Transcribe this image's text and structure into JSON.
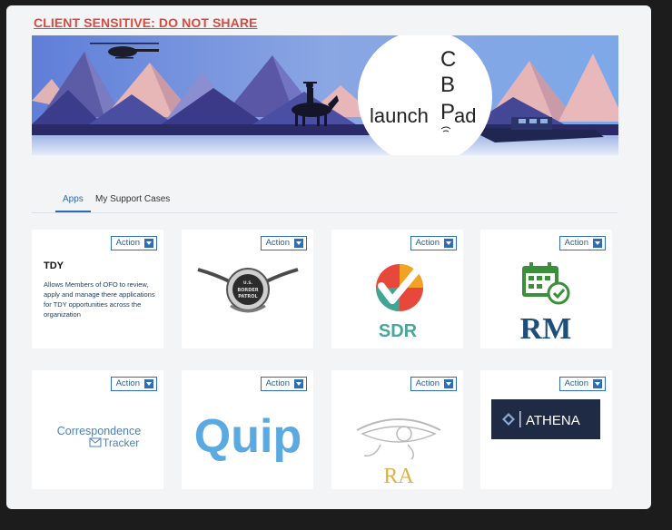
{
  "warning": "CLIENT SENSITIVE: DO NOT SHARE",
  "hero": {
    "logo_text": "launch",
    "logo_letters": [
      "C",
      "B",
      "P"
    ],
    "logo_pad": "ad"
  },
  "tabs": [
    {
      "label": "Apps",
      "active": true
    },
    {
      "label": "My Support Cases",
      "active": false
    }
  ],
  "cards": [
    {
      "action": "Action",
      "title": "TDY",
      "description": "Allows Members of OFO to review, apply and manage there applications for TDY opportunities across the organization"
    },
    {
      "action": "Action",
      "logo_text": "U.S. BORDER PATROL"
    },
    {
      "action": "Action",
      "logo_text": "SDR"
    },
    {
      "action": "Action",
      "logo_text": "RM"
    },
    {
      "action": "Action",
      "logo_text": [
        "Correspondence",
        "Tracker"
      ]
    },
    {
      "action": "Action",
      "logo_text": "Quip"
    },
    {
      "action": "Action",
      "logo_text": "RA"
    },
    {
      "action": "Action",
      "logo_text": "ATHENA"
    }
  ],
  "colors": {
    "warning": "#d8493e",
    "accent": "#2f6eb5",
    "athena_bg": "#1f2a44",
    "quip": "#5aa9e0",
    "rm": "#1e4f7a",
    "rm_green": "#3c8f3a"
  }
}
